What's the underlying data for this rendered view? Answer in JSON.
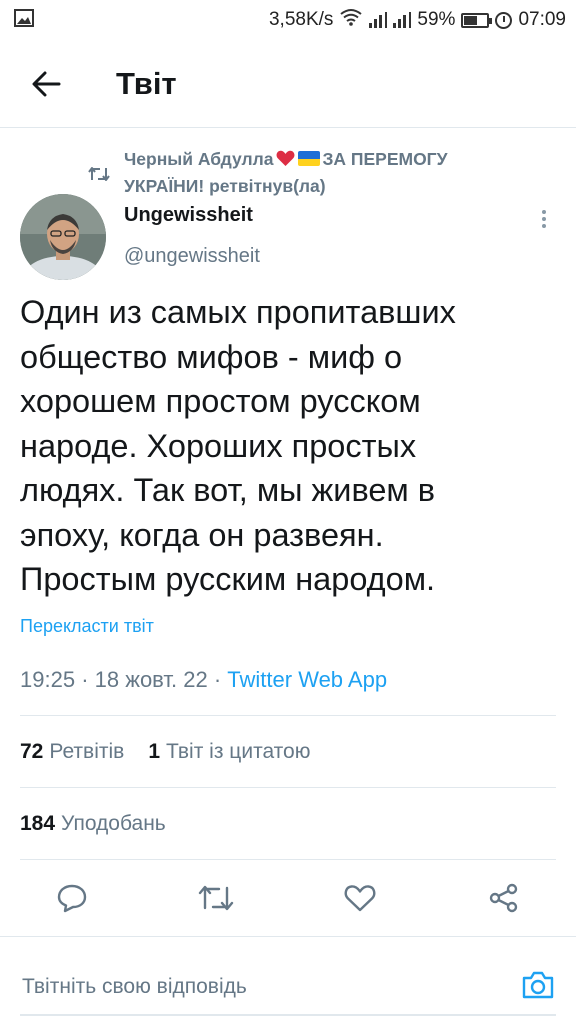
{
  "status_bar": {
    "network_speed": "3,58K/s",
    "battery_percent": "59%",
    "time": "07:09",
    "battery_level": 0.59
  },
  "header": {
    "title": "Твіт"
  },
  "retweet_context": {
    "name": "Черный Абдулла",
    "slogan": "ЗА ПЕРЕМОГУ УКРАЇНИ!",
    "action": "ретвітнув(ла)"
  },
  "author": {
    "name": "Ungewissheit",
    "handle": "@ungewissheit"
  },
  "tweet": {
    "text": "Один из самых пропитавших\nобщество мифов - миф о\nхорошем простом русском\nнароде. Хороших простых\nлюдях. Так вот, мы живем в\nэпоху, когда он развеян.\nПростым русским народом.",
    "translate_label": "Перекласти твіт",
    "time": "19:25",
    "date": "18 жовт. 22",
    "source": "Twitter Web App"
  },
  "stats": {
    "retweets_count": "72",
    "retweets_label": "Ретвітів",
    "quotes_count": "1",
    "quotes_label": "Твіт із цитатою",
    "likes_count": "184",
    "likes_label": "Уподобань"
  },
  "actions": [
    "reply-icon",
    "retweet-icon",
    "like-icon",
    "share-icon"
  ],
  "reply": {
    "placeholder": "Твітніть свою відповідь"
  },
  "colors": {
    "accent": "#1da1f2",
    "secondary_text": "#657786",
    "primary_text": "#14171a",
    "divider": "#e1e8ed"
  }
}
